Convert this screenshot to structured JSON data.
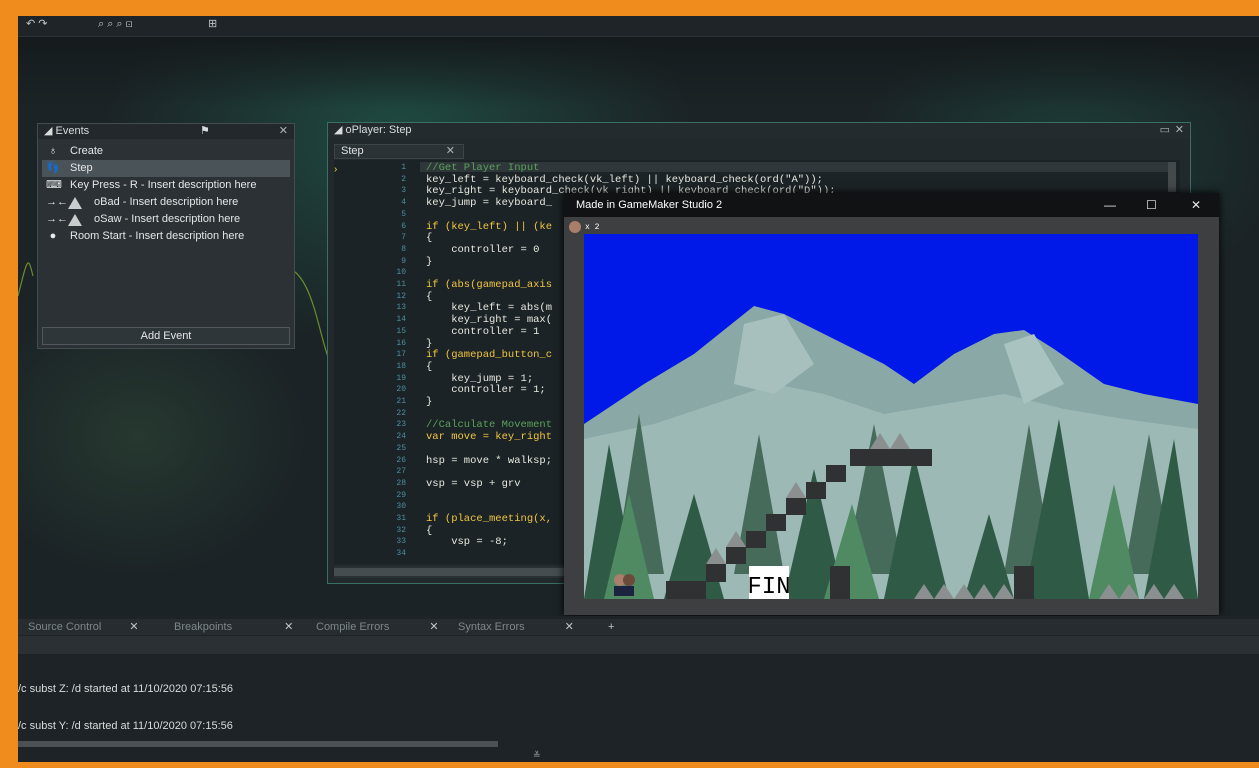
{
  "events_panel": {
    "title": "Events",
    "items": [
      {
        "label": "Create"
      },
      {
        "label": "Step"
      },
      {
        "label": "Key Press - R - Insert description here"
      },
      {
        "label": "oBad - Insert description here"
      },
      {
        "label": "oSaw - Insert description here"
      },
      {
        "label": "Room Start - Insert description here"
      }
    ],
    "add_button": "Add Event"
  },
  "code_editor": {
    "title": "oPlayer: Step",
    "tab": "Step",
    "lines": [
      {
        "n": "1",
        "code": "//Get Player Input"
      },
      {
        "n": "2",
        "code": "key_left = keyboard_check(vk_left) || keyboard_check(ord(\"A\"));"
      },
      {
        "n": "3",
        "code": "key_right = keyboard_check(vk_right) || keyboard_check(ord(\"D\"));"
      },
      {
        "n": "4",
        "code": "key_jump = keyboard_"
      },
      {
        "n": "5",
        "code": ""
      },
      {
        "n": "6",
        "code": "if (key_left) || (ke"
      },
      {
        "n": "7",
        "code": "{"
      },
      {
        "n": "8",
        "code": "    controller = 0"
      },
      {
        "n": "9",
        "code": "}"
      },
      {
        "n": "10",
        "code": ""
      },
      {
        "n": "11",
        "code": "if (abs(gamepad_axis"
      },
      {
        "n": "12",
        "code": "{"
      },
      {
        "n": "13",
        "code": "    key_left = abs(m"
      },
      {
        "n": "14",
        "code": "    key_right = max("
      },
      {
        "n": "15",
        "code": "    controller = 1"
      },
      {
        "n": "16",
        "code": "}"
      },
      {
        "n": "17",
        "code": "if (gamepad_button_c"
      },
      {
        "n": "18",
        "code": "{"
      },
      {
        "n": "19",
        "code": "    key_jump = 1;"
      },
      {
        "n": "20",
        "code": "    controller = 1;"
      },
      {
        "n": "21",
        "code": "}"
      },
      {
        "n": "22",
        "code": ""
      },
      {
        "n": "23",
        "code": "//Calculate Movement"
      },
      {
        "n": "24",
        "code": "var move = key_right"
      },
      {
        "n": "25",
        "code": ""
      },
      {
        "n": "26",
        "code": "hsp = move * walksp;"
      },
      {
        "n": "27",
        "code": ""
      },
      {
        "n": "28",
        "code": "vsp = vsp + grv"
      },
      {
        "n": "29",
        "code": ""
      },
      {
        "n": "30",
        "code": ""
      },
      {
        "n": "31",
        "code": "if (place_meeting(x,"
      },
      {
        "n": "32",
        "code": "{"
      },
      {
        "n": "33",
        "code": "    vsp = -8;"
      },
      {
        "n": "34",
        "code": ""
      }
    ]
  },
  "game_window": {
    "title": "Made in GameMaker Studio 2",
    "minimize": "—",
    "maximize": "☐",
    "close": "✕",
    "lives": "x 2",
    "sign": "FIN"
  },
  "bottom_panel": {
    "tabs": [
      "Source Control",
      "Breakpoints",
      "Compile Errors",
      "Syntax Errors"
    ],
    "add_tab": "+",
    "output": [
      "/c subst Z: /d started at 11/10/2020 07:15:56",
      "/c subst Y: /d started at 11/10/2020 07:15:56"
    ]
  },
  "colors": {
    "frame_border": "#f08c1e",
    "sky": "#0018e8",
    "selection": "#4a5357"
  }
}
